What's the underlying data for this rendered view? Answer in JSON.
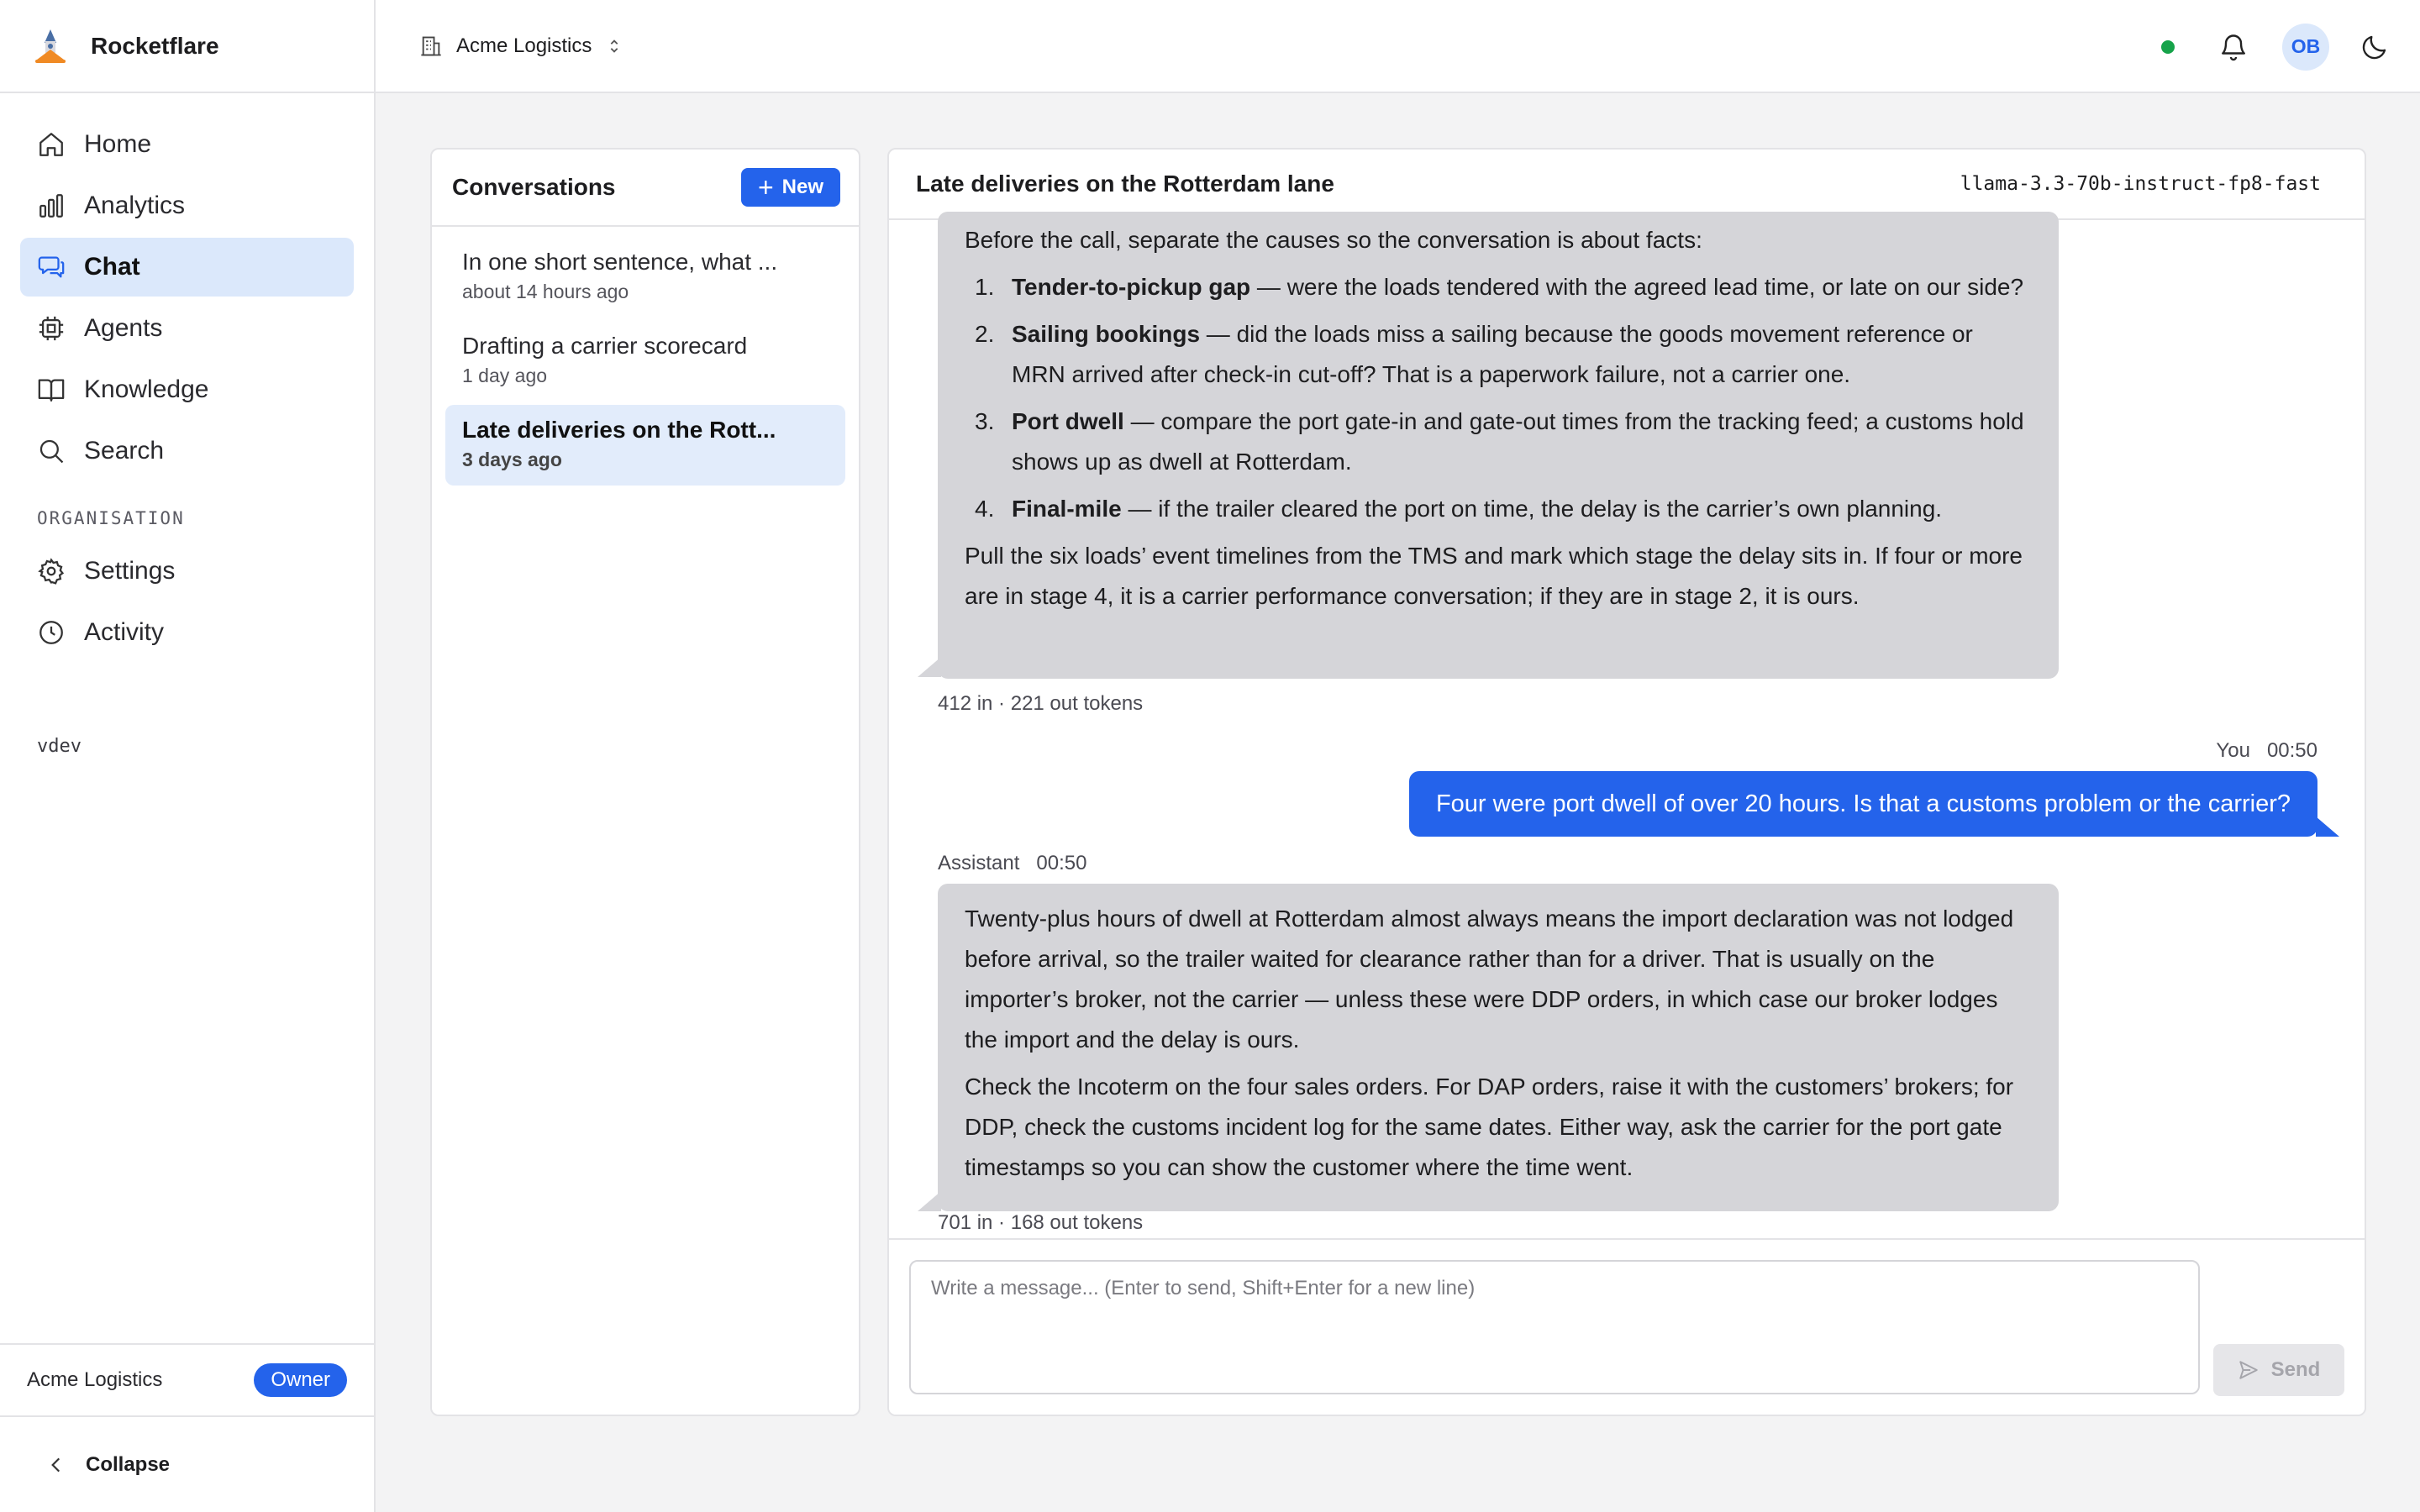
{
  "app": {
    "name": "Rocketflare",
    "logo_icon": "rocket-icon"
  },
  "sidebar": {
    "items": [
      {
        "label": "Home",
        "icon": "home-icon"
      },
      {
        "label": "Analytics",
        "icon": "bar-chart-icon"
      },
      {
        "label": "Chat",
        "icon": "chat-icon",
        "active": true
      },
      {
        "label": "Agents",
        "icon": "chip-icon"
      },
      {
        "label": "Knowledge",
        "icon": "book-icon"
      },
      {
        "label": "Search",
        "icon": "search-icon"
      }
    ],
    "section_label": "ORGANISATION",
    "org_items": [
      {
        "label": "Settings",
        "icon": "gear-icon"
      },
      {
        "label": "Activity",
        "icon": "clock-icon"
      }
    ],
    "env_label": "vdev",
    "footer": {
      "org_name": "Acme Logistics",
      "role": "Owner"
    },
    "collapse_label": "Collapse"
  },
  "topbar": {
    "org_name": "Acme Logistics",
    "status": "online",
    "avatar_initials": "OB"
  },
  "conversations": {
    "title": "Conversations",
    "new_label": "New",
    "items": [
      {
        "title": "In one short sentence, what ...",
        "time": "about 14 hours ago"
      },
      {
        "title": "Drafting a carrier scorecard",
        "time": "1 day ago"
      },
      {
        "title": "Late deliveries on the Rott...",
        "time": "3 days ago",
        "active": true
      }
    ]
  },
  "chat": {
    "title": "Late deliveries on the Rotterdam lane",
    "model": "llama-3.3-70b-instruct-fp8-fast",
    "messages": {
      "a1": {
        "intro": "Before the call, separate the causes so the conversation is about facts:",
        "steps": [
          {
            "n": "1.",
            "bold": "Tender-to-pickup gap",
            "text": " — were the loads tendered with the agreed lead time, or late on our side?"
          },
          {
            "n": "2.",
            "bold": "Sailing bookings",
            "text": " — did the loads miss a sailing because the goods movement reference or MRN arrived after check-in cut-off? That is a paperwork failure, not a carrier one."
          },
          {
            "n": "3.",
            "bold": "Port dwell",
            "text": " — compare the port gate-in and gate-out times from the tracking feed; a customs hold shows up as dwell at Rotterdam."
          },
          {
            "n": "4.",
            "bold": "Final-mile",
            "text": " — if the trailer cleared the port on time, the delay is the carrier’s own planning."
          }
        ],
        "outro": "Pull the six loads’ event timelines from the TMS and mark which stage the delay sits in. If four or more are in stage 4, it is a carrier performance conversation; if they are in stage 2, it is ours.",
        "tokens": "412 in · 221 out tokens"
      },
      "u1": {
        "author": "You",
        "time": "00:50",
        "text": "Four were port dwell of over 20 hours. Is that a customs problem or the carrier?"
      },
      "a2": {
        "author": "Assistant",
        "time": "00:50",
        "p1": "Twenty-plus hours of dwell at Rotterdam almost always means the import declaration was not lodged before arrival, so the trailer waited for clearance rather than for a driver. That is usually on the importer’s broker, not the carrier — unless these were DDP orders, in which case our broker lodges the import and the delay is ours.",
        "p2": "Check the Incoterm on the four sales orders. For DAP orders, raise it with the customers’ brokers; for DDP, check the customs incident log for the same dates. Either way, ask the carrier for the port gate timestamps so you can show the customer where the time went.",
        "tokens": "701 in · 168 out tokens"
      }
    },
    "composer": {
      "placeholder": "Write a message... (Enter to send, Shift+Enter for a new line)",
      "send_label": "Send"
    }
  },
  "colors": {
    "accent": "#2463eb",
    "bubble_assistant": "#d5d5d9",
    "status": "#16a34a"
  }
}
